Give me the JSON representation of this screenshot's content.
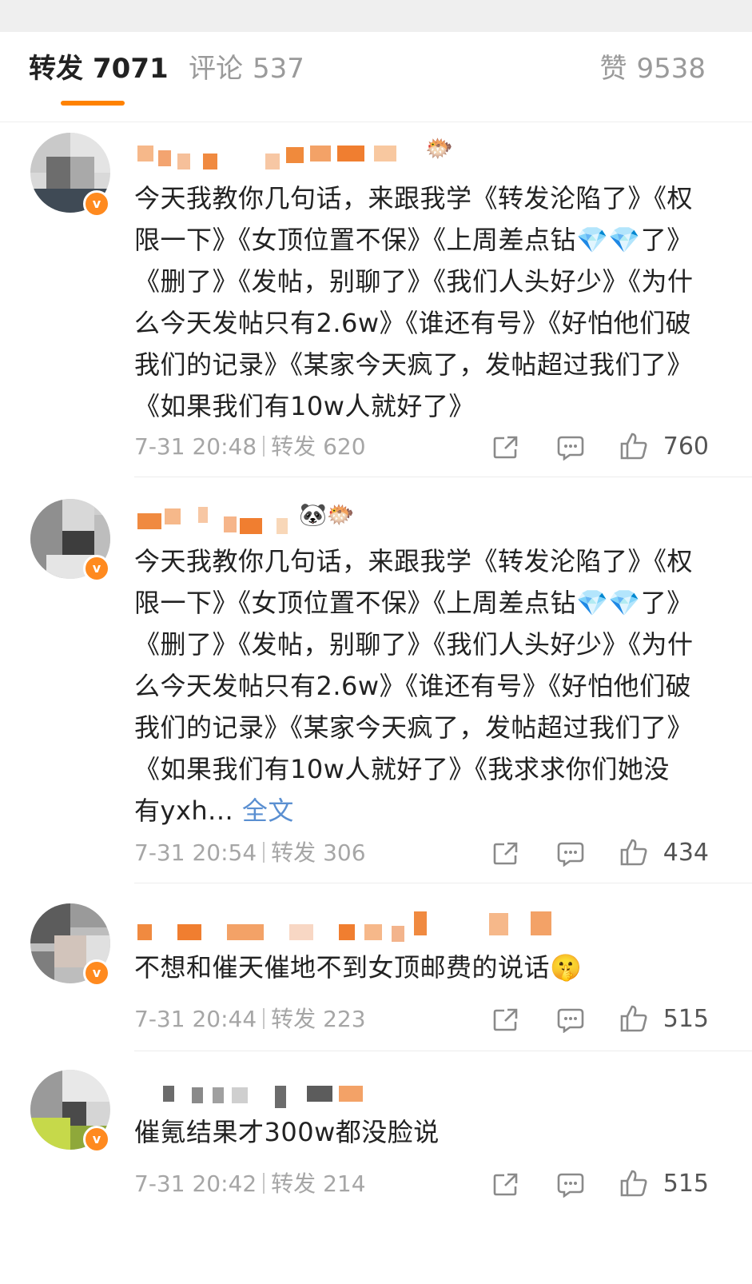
{
  "tabs": {
    "repost": {
      "label": "转发",
      "count": "7071"
    },
    "comment": {
      "label": "评论",
      "count": "537"
    },
    "like": {
      "label": "赞",
      "count": "9538"
    }
  },
  "reposts": [
    {
      "text": "今天我教你几句话，来跟我学《转发沦陷了》《权限一下》《女顶位置不保》《上周差点钻💎💎了》《删了》《发帖，别聊了》《我们人头好少》《为什么今天发帖只有2.6w》《谁还有号》《好怕他们破我们的记录》《某家今天疯了，发帖超过我们了》《如果我们有10w人就好了》",
      "more": "",
      "time": "7-31 20:48",
      "repost_label": "转发",
      "repost_count": "620",
      "likes": "760",
      "name_emoji": "🐡"
    },
    {
      "text": "今天我教你几句话，来跟我学《转发沦陷了》《权限一下》《女顶位置不保》《上周差点钻💎💎了》《删了》《发帖，别聊了》《我们人头好少》《为什么今天发帖只有2.6w》《谁还有号》《好怕他们破我们的记录》《某家今天疯了，发帖超过我们了》《如果我们有10w人就好了》《我求求你们她没有yxh...",
      "more": "全文",
      "time": "7-31 20:54",
      "repost_label": "转发",
      "repost_count": "306",
      "likes": "434",
      "name_emoji": "🐼🐡"
    },
    {
      "text": "不想和催天催地不到女顶邮费的说话🤫",
      "more": "",
      "time": "7-31 20:44",
      "repost_label": "转发",
      "repost_count": "223",
      "likes": "515",
      "name_emoji": ""
    },
    {
      "text": "催氪结果才300w都没脸说",
      "more": "",
      "time": "7-31 20:42",
      "repost_label": "转发",
      "repost_count": "214",
      "likes": "515",
      "name_emoji": ""
    }
  ],
  "colors": {
    "accent": "#ff8200",
    "link": "#5a8fd1",
    "verified": "#ff8a1f"
  },
  "icons": [
    "share-icon",
    "comment-icon",
    "like-icon",
    "verified-badge-icon"
  ]
}
